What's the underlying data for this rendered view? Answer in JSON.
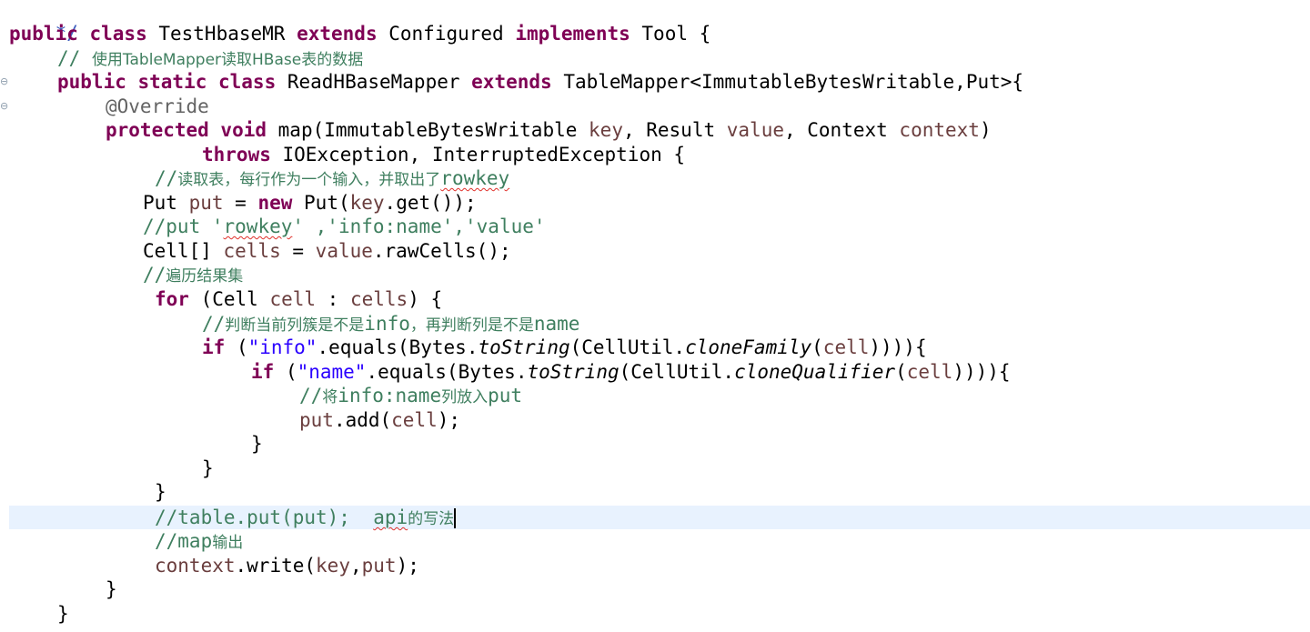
{
  "editor": {
    "fold_marker": "⊖",
    "colors": {
      "keyword": "#7f0055",
      "comment": "#3f7f5f",
      "string": "#2a00ff",
      "local_variable": "#6a3e3e",
      "annotation": "#646464",
      "javadoc": "#3f5fbf",
      "current_line": "#e8f2fe"
    },
    "lines": {
      "l0": {
        "text": "*/"
      },
      "l1": {
        "kw1": "public class",
        "t1": " TestHbaseMR ",
        "kw2": "extends",
        "t2": " Configured ",
        "kw3": "implements",
        "t3": " Tool {"
      },
      "l2": {
        "cm": "// ",
        "cmz": "使用TableMapper读取HBase表的数据"
      },
      "l3": {
        "kw1": "public static class",
        "t1": " ReadHBaseMapper ",
        "kw2": "extends",
        "t2": " TableMapper<ImmutableBytesWritable,Put>{"
      },
      "l4": {
        "ann": "@Override"
      },
      "l5": {
        "kw1": "protected void",
        "t1": " map(ImmutableBytesWritable ",
        "v1": "key",
        "t2": ", Result ",
        "v2": "value",
        "t3": ", Context ",
        "v3": "context",
        "t4": ")"
      },
      "l6": {
        "kw1": "throws",
        "t1": " IOException, InterruptedException {"
      },
      "l7": {
        "cm": "//",
        "cmz": "读取表，每行作为一个输入，并取出了",
        "cm2": "rowkey"
      },
      "l8": {
        "t1": "Put ",
        "v1": "put",
        "t2": " = ",
        "kw1": "new",
        "t3": " Put(",
        "v2": "key",
        "t4": ".get());"
      },
      "l9": {
        "cm1": "//put '",
        "cm2": "rowkey",
        "cm3": "' ,'info:name','value'"
      },
      "l10": {
        "t1": "Cell[] ",
        "v1": "cells",
        "t2": " = ",
        "v2": "value",
        "t3": ".rawCells();"
      },
      "l11": {
        "cm": "//",
        "cmz": "遍历结果集"
      },
      "l12": {
        "kw1": "for",
        "t1": " (Cell ",
        "v1": "cell",
        "t2": " : ",
        "v2": "cells",
        "t3": ") {"
      },
      "l13": {
        "cm": "//",
        "cmz": "判断当前列簇是不是",
        "cm2": "info",
        "cmz2": "，再判断列是不是",
        "cm3": "name"
      },
      "l14": {
        "kw1": "if",
        "t1": " (",
        "s1": "\"info\"",
        "t2": ".equals(Bytes.",
        "i1": "toString",
        "t3": "(CellUtil.",
        "i2": "cloneFamily",
        "t4": "(",
        "v1": "cell",
        "t5": ")))){"
      },
      "l15": {
        "kw1": "if",
        "t1": " (",
        "s1": "\"name\"",
        "t2": ".equals(Bytes.",
        "i1": "toString",
        "t3": "(CellUtil.",
        "i2": "cloneQualifier",
        "t4": "(",
        "v1": "cell",
        "t5": ")))){"
      },
      "l16": {
        "cm": "//",
        "cmz": "将",
        "cm2": "info:name",
        "cmz2": "列放入",
        "cm3": "put"
      },
      "l17": {
        "v1": "put",
        "t1": ".add(",
        "v2": "cell",
        "t2": ");"
      },
      "l18": {
        "text": "}"
      },
      "l19": {
        "text": "}"
      },
      "l20": {
        "text": "}"
      },
      "l21": {
        "cm1": "//table.put(put);  ",
        "cm2": "api",
        "cmz": "的写法"
      },
      "l22": {
        "cm": "//map",
        "cmz": "输出"
      },
      "l23": {
        "v1": "context",
        "t1": ".write(",
        "v2": "key",
        "t2": ",",
        "v3": "put",
        "t3": ");"
      },
      "l24": {
        "text": "}"
      },
      "l25": {
        "text": "}"
      }
    }
  }
}
